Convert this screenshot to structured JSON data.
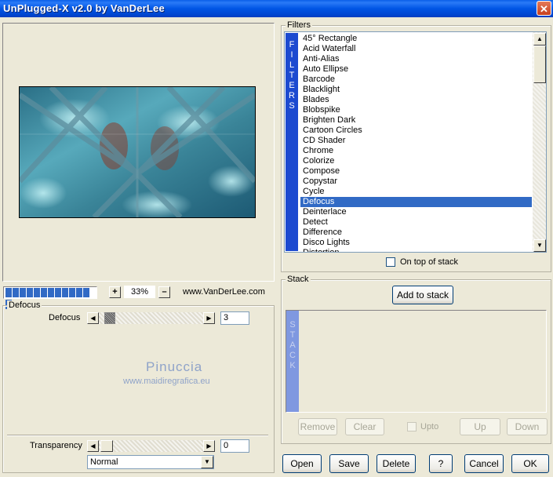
{
  "window": {
    "title": "UnPlugged-X v2.0 by VanDerLee",
    "close_label": "✕"
  },
  "preview": {
    "zoom_value": "33%",
    "zoom_in": "+",
    "zoom_out": "–",
    "website": "www.VanDerLee.com",
    "progress_segments": 13
  },
  "params": {
    "group_label": "Defocus",
    "defocus_label": "Defocus",
    "defocus_value": "3",
    "defocus_level": 0.06,
    "watermark_name": "Pinuccia",
    "watermark_url": "www.maidiregrafica.eu",
    "transparency_label": "Transparency",
    "transparency_value": "0",
    "transparency_level": 0.02,
    "blend_mode": "Normal"
  },
  "filters": {
    "group_label": "Filters",
    "side_label": "FILTERS",
    "items": [
      "45° Rectangle",
      "Acid Waterfall",
      "Anti-Alias",
      "Auto Ellipse",
      "Barcode",
      "Blacklight",
      "Blades",
      "Blobspike",
      "Brighten Dark",
      "Cartoon Circles",
      "CD Shader",
      "Chrome",
      "Colorize",
      "Compose",
      "Copystar",
      "Cycle",
      "Defocus",
      "Deinterlace",
      "Detect",
      "Difference",
      "Disco Lights",
      "Distortion"
    ],
    "selected": "Defocus",
    "on_top_label": "On top of stack"
  },
  "stack": {
    "group_label": "Stack",
    "side_label": "STACK",
    "add_button": "Add to stack",
    "remove_button": "Remove",
    "clear_button": "Clear",
    "upto_label": "Upto",
    "up_button": "Up",
    "down_button": "Down"
  },
  "footer": {
    "open": "Open",
    "save": "Save",
    "delete": "Delete",
    "help": "?",
    "cancel": "Cancel",
    "ok": "OK"
  },
  "colors": {
    "accent": "#316ac5",
    "titlebar": "#0055e5",
    "panel": "#ece9d8"
  }
}
